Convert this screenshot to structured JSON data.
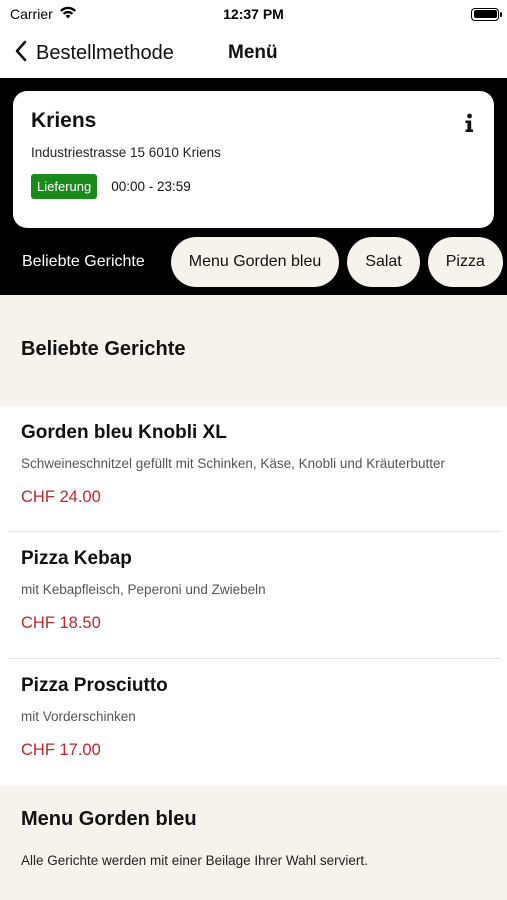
{
  "status_bar": {
    "carrier": "Carrier",
    "time": "12:37 PM"
  },
  "nav": {
    "back_label": "Bestellmethode",
    "title": "Menü"
  },
  "store": {
    "name": "Kriens",
    "address": "Industriestrasse 15 6010 Kriens",
    "delivery_badge": "Lieferung",
    "hours": "00:00 - 23:59"
  },
  "categories": {
    "active": "Beliebte Gerichte",
    "pills": [
      "Menu Gorden bleu",
      "Salat",
      "Pizza"
    ]
  },
  "sections": [
    {
      "title": "Beliebte Gerichte",
      "dishes": [
        {
          "name": "Gorden bleu Knobli XL",
          "description": "Schweineschnitzel gefüllt mit Schinken, Käse, Knobli und Kräuterbutter",
          "price": "CHF 24.00"
        },
        {
          "name": "Pizza Kebap",
          "description": "mit Kebapfleisch, Peperoni und Zwiebeln",
          "price": "CHF 18.50"
        },
        {
          "name": "Pizza Prosciutto",
          "description": "mit Vorderschinken",
          "price": "CHF 17.00"
        }
      ]
    },
    {
      "title": "Menu Gorden bleu",
      "note": "Alle Gerichte werden mit einer Beilage Ihrer Wahl serviert."
    }
  ],
  "colors": {
    "accent_price": "#c0262d",
    "badge_green": "#1a8a1a",
    "header_bg": "#000000",
    "section_bg": "#f6f3ef"
  },
  "icons": {
    "back": "chevron-left-icon",
    "info": "info-icon",
    "wifi": "wifi-icon",
    "battery": "battery-icon"
  }
}
